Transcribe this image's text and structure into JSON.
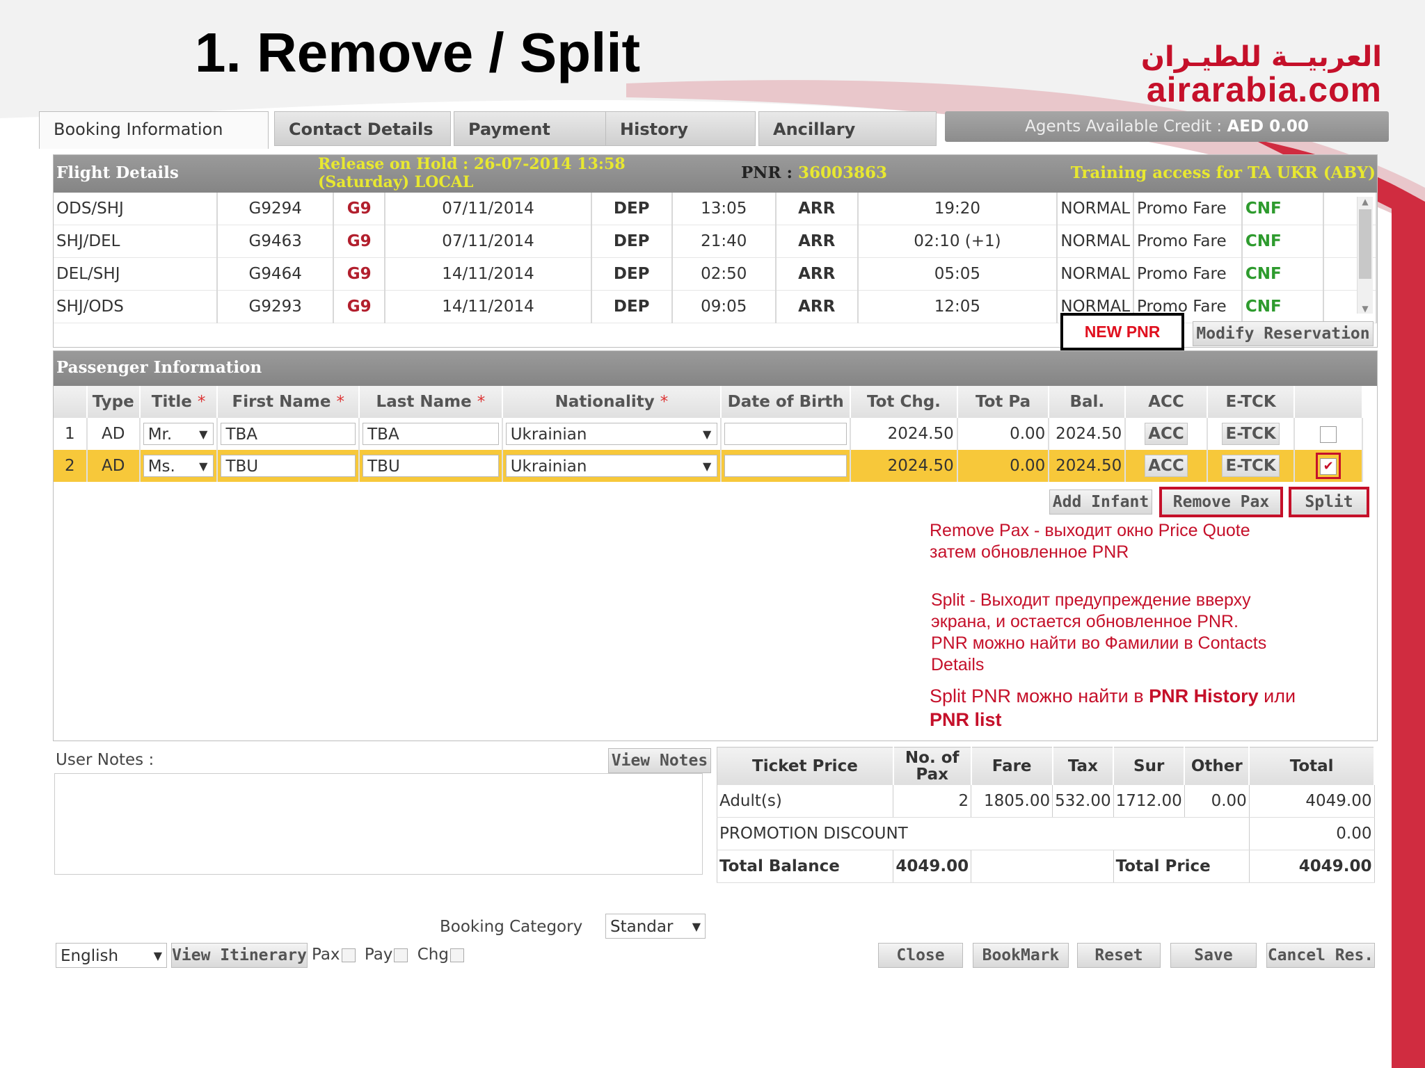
{
  "slide_title": "1. Remove / Split",
  "logo": {
    "arabic": "العربيــة للطيـران",
    "english": "airarabia.com"
  },
  "tabs": [
    "Booking Information",
    "Contact Details",
    "Payment",
    "History",
    "Ancillary"
  ],
  "credit": {
    "label": "Agents Available Credit :",
    "value": "AED 0.00"
  },
  "flight": {
    "header": "Flight Details",
    "release_line1": "Release on Hold : 26-07-2014 13:58",
    "release_line2": "(Saturday) LOCAL",
    "pnr_label": "PNR :",
    "pnr_value": "36003863",
    "training": "Training access for TA UKR (ABY)",
    "rows": [
      {
        "seg": "ODS/SHJ",
        "flight": "G9294",
        "carrier": "G9",
        "date": "07/11/2014",
        "dep": "DEP",
        "dep_time": "13:05",
        "arr": "ARR",
        "arr_time": "19:20",
        "cls": "NORMAL",
        "fare": "Promo Fare",
        "status": "CNF"
      },
      {
        "seg": "SHJ/DEL",
        "flight": "G9463",
        "carrier": "G9",
        "date": "07/11/2014",
        "dep": "DEP",
        "dep_time": "21:40",
        "arr": "ARR",
        "arr_time": "02:10 (+1)",
        "cls": "NORMAL",
        "fare": "Promo Fare",
        "status": "CNF"
      },
      {
        "seg": "DEL/SHJ",
        "flight": "G9464",
        "carrier": "G9",
        "date": "14/11/2014",
        "dep": "DEP",
        "dep_time": "02:50",
        "arr": "ARR",
        "arr_time": "05:05",
        "cls": "NORMAL",
        "fare": "Promo Fare",
        "status": "CNF"
      },
      {
        "seg": "SHJ/ODS",
        "flight": "G9293",
        "carrier": "G9",
        "date": "14/11/2014",
        "dep": "DEP",
        "dep_time": "09:05",
        "arr": "ARR",
        "arr_time": "12:05",
        "cls": "NORMAL",
        "fare": "Promo Fare",
        "status": "CNF"
      }
    ],
    "new_pnr": "NEW PNR",
    "modify": "Modify Reservation"
  },
  "passenger": {
    "header": "Passenger Information",
    "columns": {
      "type": "Type",
      "title": "Title",
      "first": "First Name",
      "last": "Last Name",
      "nat": "Nationality",
      "dob": "Date of Birth",
      "totchg": "Tot Chg.",
      "totpa": "Tot Pa",
      "bal": "Bal.",
      "acc": "ACC",
      "etck": "E-TCK",
      "asterisk": "*"
    },
    "rows": [
      {
        "no": "1",
        "type": "AD",
        "title": "Mr.",
        "first": "TBA",
        "last": "TBA",
        "nat": "Ukrainian",
        "dob": "",
        "totchg": "2024.50",
        "totpa": "0.00",
        "bal": "2024.50",
        "acc": "ACC",
        "etck": "E-TCK",
        "checked": false
      },
      {
        "no": "2",
        "type": "AD",
        "title": "Ms.",
        "first": "TBU",
        "last": "TBU",
        "nat": "Ukrainian",
        "dob": "",
        "totchg": "2024.50",
        "totpa": "0.00",
        "bal": "2024.50",
        "acc": "ACC",
        "etck": "E-TCK",
        "checked": true
      }
    ],
    "add_infant": "Add Infant",
    "remove_pax": "Remove Pax",
    "split": "Split"
  },
  "notes": {
    "n1_line1": "Remove Pax - выходит окно Price Quote",
    "n1_line2": "затем обновленное PNR",
    "n2_line1": "Split - Выходит предупреждение вверху",
    "n2_line2": "экрана, и остается обновленное PNR.",
    "n2_line3": "PNR можно найти во Фамилии в Contacts",
    "n2_line4": "Details",
    "n3_pre": "Split PNR можно найти в ",
    "n3_b1": "PNR History",
    "n3_mid": " или",
    "n3_b2": "PNR list"
  },
  "user_notes": {
    "label": "User Notes :",
    "view": "View Notes"
  },
  "price": {
    "headers": {
      "ticket": "Ticket Price",
      "pax": "No. of Pax",
      "fare": "Fare",
      "tax": "Tax",
      "sur": "Sur",
      "other": "Other",
      "total": "Total"
    },
    "adult": {
      "label": "Adult(s)",
      "pax": "2",
      "fare": "1805.00",
      "tax": "532.00",
      "sur": "1712.00",
      "other": "0.00",
      "total": "4049.00"
    },
    "promo": {
      "label": "PROMOTION DISCOUNT",
      "value": "0.00"
    },
    "balance": {
      "label": "Total Balance",
      "value": "4049.00",
      "price_label": "Total Price",
      "price_value": "4049.00"
    }
  },
  "footer": {
    "booking_category_label": "Booking Category",
    "booking_category_value": "Standar",
    "language": "English",
    "view_itinerary": "View Itinerary",
    "pax": "Pax",
    "pay": "Pay",
    "chg": "Chg",
    "buttons": [
      "Close",
      "BookMark",
      "Reset",
      "Save",
      "Cancel Res."
    ]
  },
  "colors": {
    "accent_red": "#c5102a",
    "highlight_yellow": "#f7c83a",
    "status_green": "#2e9b2e",
    "header_gray": "#8f8f8f"
  }
}
